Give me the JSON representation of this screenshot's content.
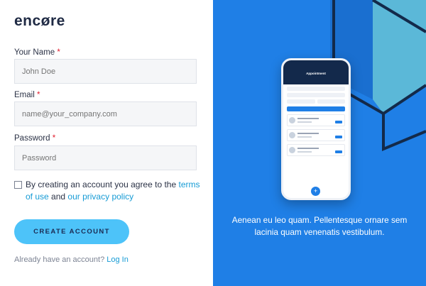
{
  "brand": {
    "logo": "encøre"
  },
  "form": {
    "name_label": "Your Name",
    "name_placeholder": "John Doe",
    "email_label": "Email",
    "email_placeholder": "name@your_company.com",
    "password_label": "Password",
    "password_placeholder": "Password",
    "required_mark": "*",
    "agree_prefix": "By creating an account you agree to the",
    "terms_link": "terms of use",
    "agree_middle": "and",
    "privacy_link": "our privacy policy",
    "submit_label": "CREATE ACCOUNT",
    "already_text": "Already have an account?",
    "login_link": "Log In"
  },
  "promo": {
    "text": "Aenean eu leo quam. Pellentesque ornare sem lacinia quam venenatis vestibulum.",
    "phone_title": "Appointment",
    "accent": "#1f7fe6"
  },
  "colors": {
    "button": "#4dc3f9",
    "link": "#169bd5",
    "panel": "#1f7fe6",
    "required": "#e11d2e"
  }
}
